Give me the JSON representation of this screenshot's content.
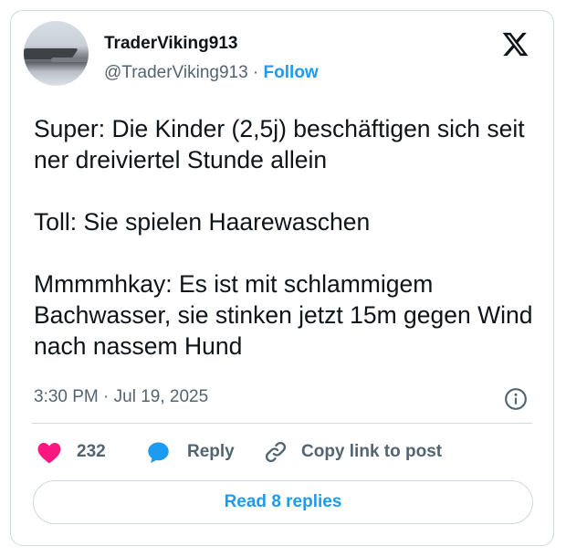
{
  "author": {
    "display_name": "TraderViking913",
    "handle": "@TraderViking913",
    "separator": " · ",
    "follow_label": "Follow"
  },
  "tweet": {
    "text": "Super: Die Kinder (2,5j) beschäftigen sich seit ner dreiviertel Stunde allein\n\nToll: Sie spielen Haarewaschen\n\nMmmmhkay: Es ist mit schlammigem Bachwasser, sie stinken jetzt 15m gegen Wind nach nassem Hund",
    "timestamp": "3:30 PM · Jul 19, 2025"
  },
  "actions": {
    "like_count": "232",
    "reply_label": "Reply",
    "copy_link_label": "Copy link to post"
  },
  "read_replies_label": "Read 8 replies",
  "icons": {
    "logo": "x-logo-icon",
    "info": "info-icon",
    "like": "heart-icon",
    "reply": "reply-bubble-icon",
    "copy": "link-icon"
  },
  "colors": {
    "accent": "#1d9bf0",
    "like": "#f91880",
    "text": "#0f1419",
    "secondary": "#536471",
    "border": "#cfd9de"
  }
}
